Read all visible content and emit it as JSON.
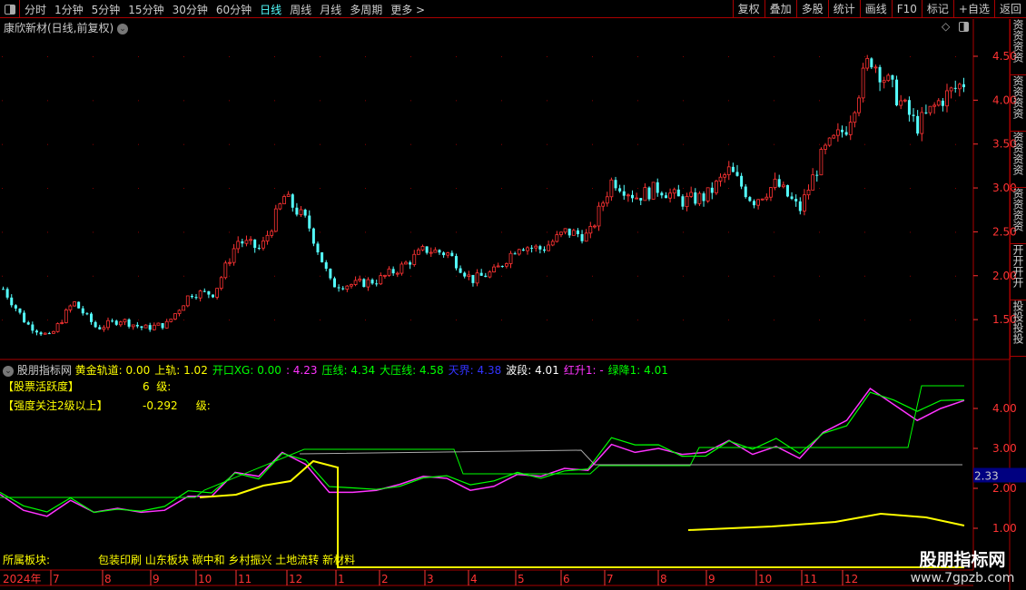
{
  "toolbar": {
    "periods": [
      "分时",
      "1分钟",
      "5分钟",
      "15分钟",
      "30分钟",
      "60分钟",
      "日线",
      "周线",
      "月线",
      "多周期",
      "更多 >"
    ],
    "active": "日线",
    "right_buttons": [
      "复权",
      "叠加",
      "多股",
      "统计",
      "画线",
      "F10",
      "标记",
      "+自选",
      "返回"
    ]
  },
  "main": {
    "title": "康欣新材(日线,前复权)",
    "price_ticks": [
      "4.50",
      "4.00",
      "3.50",
      "3.00",
      "2.50",
      "2.00",
      "1.50"
    ]
  },
  "indicator": {
    "name": "股朋指标网",
    "values": [
      {
        "label": "黄金轨道:",
        "value": "0.00",
        "color": "#ffff00"
      },
      {
        "label": "上轨:",
        "value": "1.02",
        "color": "#ffff00"
      },
      {
        "label": "开口XG:",
        "value": "0.00",
        "color": "#00ff00"
      },
      {
        "label": ":",
        "value": "4.23",
        "color": "#ff33ff"
      },
      {
        "label": "压线:",
        "value": "4.34",
        "color": "#00ff00"
      },
      {
        "label": "大压线:",
        "value": "4.58",
        "color": "#00ff00"
      },
      {
        "label": "天界:",
        "value": "4.38",
        "color": "#3333ff"
      },
      {
        "label": "波段:",
        "value": "4.01",
        "color": "#ffffff"
      },
      {
        "label": "红升1:",
        "value": "-",
        "color": "#ff33ff"
      },
      {
        "label": "绿降1:",
        "value": "4.01",
        "color": "#00ff00"
      }
    ],
    "row1_label": "【股票活跃度】",
    "row1_value": "6",
    "row1_unit": "级:",
    "row2_label": "【强度关注2级以上】",
    "row2_value": "-0.292",
    "row2_unit": "级:",
    "ticks": [
      "4.00",
      "3.00",
      "2.00",
      "1.00"
    ],
    "current": "2.33"
  },
  "sector": {
    "label": "所属板块:",
    "value": "包装印刷 山东板块 碳中和 乡村振兴 土地流转 新材料"
  },
  "time_axis": [
    "2024年",
    "7",
    "8",
    "9",
    "10",
    "11",
    "12",
    "1",
    "2",
    "3",
    "4",
    "5",
    "6",
    "7",
    "8",
    "9",
    "10",
    "11",
    "12"
  ],
  "watermark": {
    "name": "股朋指标网",
    "url": "www.7gpzb.com"
  },
  "right_strip": [
    "资",
    "资",
    "资",
    "资",
    "开",
    "投"
  ],
  "chart_data": {
    "type": "candlestick",
    "title": "康欣新材(日线,前复权)",
    "ylim": [
      1.2,
      4.75
    ],
    "close_keypoints": [
      1.85,
      1.45,
      1.3,
      1.7,
      1.4,
      1.5,
      1.4,
      1.45,
      1.8,
      1.8,
      2.4,
      2.3,
      2.9,
      2.6,
      1.9,
      1.9,
      1.95,
      2.1,
      2.3,
      2.25,
      1.95,
      2.05,
      2.35,
      2.3,
      2.5,
      2.45,
      3.1,
      2.9,
      3.0,
      2.85,
      2.9,
      3.2,
      2.85,
      3.05,
      2.75,
      3.4,
      3.7,
      4.5,
      4.1,
      3.7,
      4.0,
      4.2
    ]
  },
  "colors": {
    "up": "#ff3333",
    "down": "#54ffff",
    "axis": "#ff3333",
    "border": "#aa0000"
  }
}
